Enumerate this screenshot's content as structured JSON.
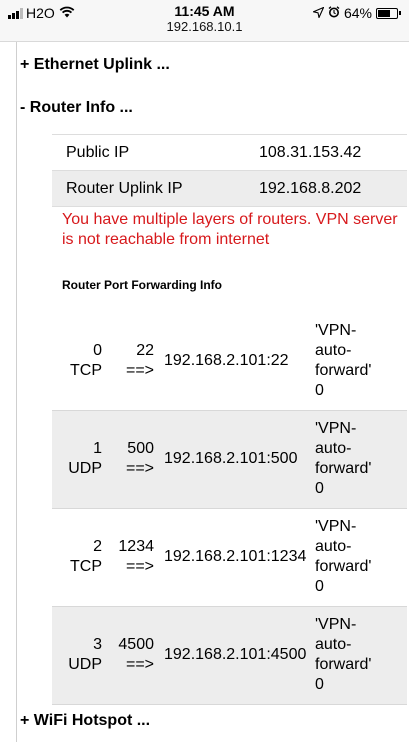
{
  "status_bar": {
    "carrier": "H2O",
    "time": "11:45 AM",
    "url": "192.168.10.1",
    "battery": "64%",
    "battery_level": 0.64,
    "icons": [
      "signal-bars-icon",
      "wifi-icon",
      "location-arrow-icon",
      "alarm-icon",
      "battery-icon"
    ]
  },
  "sections": {
    "ethernet": "+ Ethernet Uplink ...",
    "router": "- Router Info ...",
    "wifi": "+ WiFi Hotspot ..."
  },
  "router_info": {
    "rows": [
      {
        "label": "Public IP",
        "value": "108.31.153.42"
      },
      {
        "label": "Router Uplink IP",
        "value": "192.168.8.202"
      }
    ],
    "warning": "You have multiple layers of routers. VPN server is not reachable from internet"
  },
  "port_forwarding": {
    "title": "Router Port Forwarding Info",
    "rows": [
      {
        "idx": "0",
        "proto": "TCP",
        "port": "22",
        "arrow": "==>",
        "address": "192.168.2.101:22",
        "desc": [
          "'VPN-",
          "auto-",
          "forward'",
          "0"
        ]
      },
      {
        "idx": "1",
        "proto": "UDP",
        "port": "500",
        "arrow": "==>",
        "address": "192.168.2.101:500",
        "desc": [
          "'VPN-",
          "auto-",
          "forward'",
          "0"
        ]
      },
      {
        "idx": "2",
        "proto": "TCP",
        "port": "1234",
        "arrow": "==>",
        "address": "192.168.2.101:1234",
        "desc": [
          "'VPN-",
          "auto-",
          "forward'",
          "0"
        ]
      },
      {
        "idx": "3",
        "proto": "UDP",
        "port": "4500",
        "arrow": "==>",
        "address": "192.168.2.101:4500",
        "desc": [
          "'VPN-",
          "auto-",
          "forward'",
          "0"
        ]
      }
    ]
  },
  "colors": {
    "warning": "#d7191c",
    "row_shade": "#ededed"
  }
}
